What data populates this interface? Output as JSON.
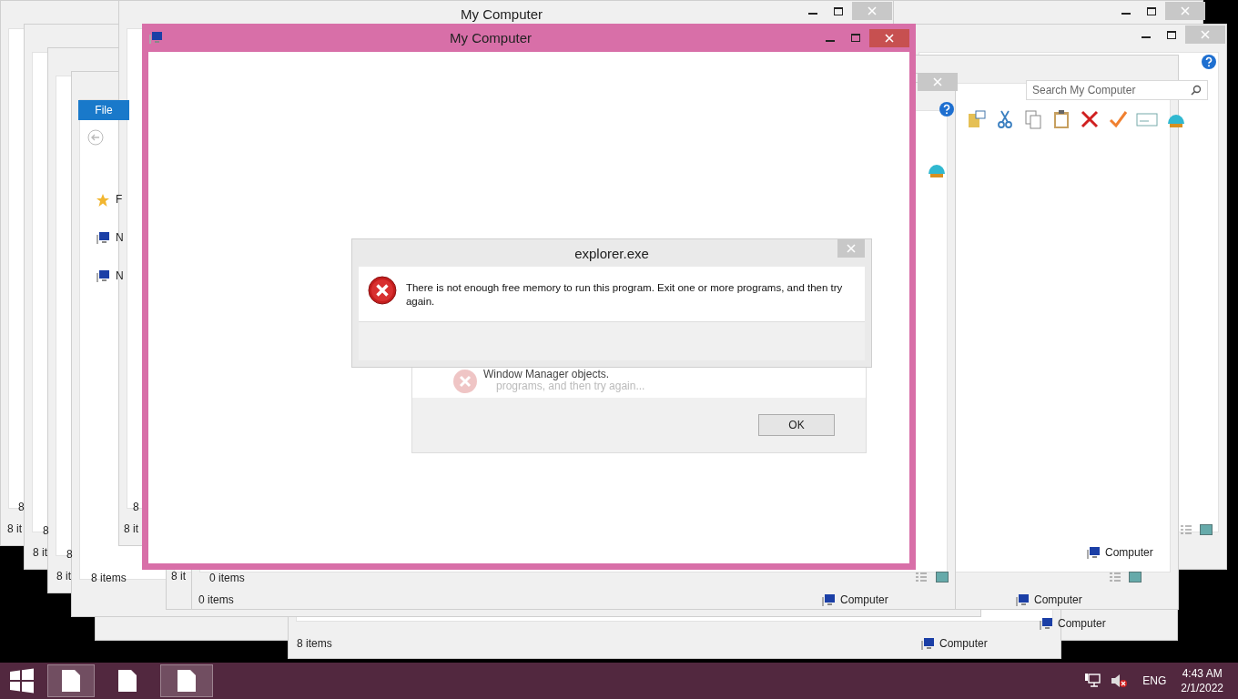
{
  "background_windows": {
    "title": "My Computer",
    "status_texts": [
      "8 it",
      "8 it",
      "8 it",
      "8 it",
      "8 items",
      "8 it",
      "0 items",
      "0 items",
      "8 items"
    ],
    "item_counts": [
      "8",
      "8",
      "8",
      "8"
    ],
    "locations": [
      "Computer",
      "Computer",
      "Computer",
      "Computer",
      "Computer"
    ],
    "menu_tab": "File",
    "nav_labels": [
      "F",
      "N",
      "N"
    ],
    "search": {
      "placeholder": "Search My Computer"
    }
  },
  "main_window": {
    "title": "My Computer"
  },
  "dialog_behind": {
    "lines": [
      "Window Manager objects.",
      "programs, and then try again..."
    ],
    "button": "OK"
  },
  "dialog": {
    "title": "explorer.exe",
    "message": "There is not enough free memory to run this program. Exit one or more programs, and then try again."
  },
  "taskbar": {
    "buttons": [
      {
        "selected": true
      },
      {
        "selected": false
      },
      {
        "selected": true
      }
    ],
    "language": "ENG",
    "time": "4:43 AM",
    "date": "2/1/2022"
  }
}
